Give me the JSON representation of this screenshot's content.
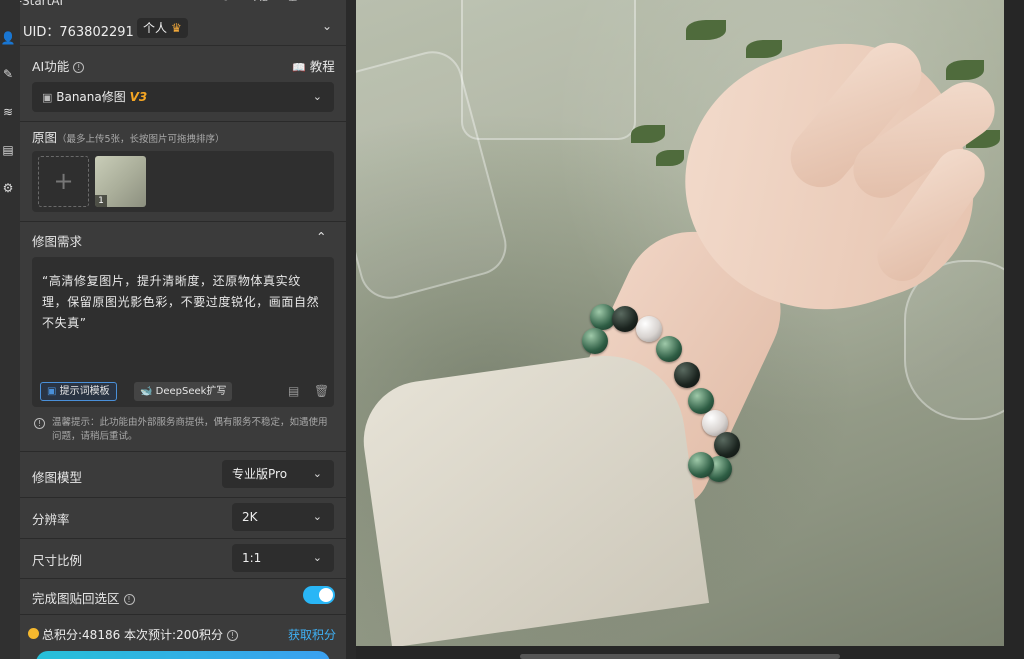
{
  "app": {
    "title": "插件StartAI"
  },
  "account": {
    "uid_label": "UID：763802291",
    "persona": "个人"
  },
  "ai_function": {
    "label": "AI功能",
    "tutorial": "教程",
    "selected": "Banana修图",
    "version": "V3"
  },
  "source_image": {
    "label": "原图",
    "hint": "（最多上传5张，长按图片可拖拽排序）",
    "thumb_index": "1"
  },
  "edit_request": {
    "label": "修图需求",
    "prompt": "“高清修复图片，提升清晰度，还原物体真实纹理，保留原图光影色彩，不要过度锐化，画面自然不失真”",
    "template_button": "提示词模板",
    "deepseek_button": "DeepSeek扩写"
  },
  "notice": "温馨提示：此功能由外部服务商提供，偶有服务不稳定，如遇使用问题，请稍后重试。",
  "settings": {
    "model_label": "修图模型",
    "model_value": "专业版Pro",
    "resolution_label": "分辨率",
    "resolution_value": "2K",
    "ratio_label": "尺寸比例",
    "ratio_value": "1:1",
    "paste_back_label": "完成图贴回选区",
    "paste_back_on": true
  },
  "footer": {
    "points_text": "总积分:48186  本次预计:200积分",
    "get_points": "获取积分"
  },
  "colors": {
    "accent": "#29b6f6",
    "link": "#3fb1f5",
    "coin": "#f5b82e",
    "version": "#f5a623"
  }
}
